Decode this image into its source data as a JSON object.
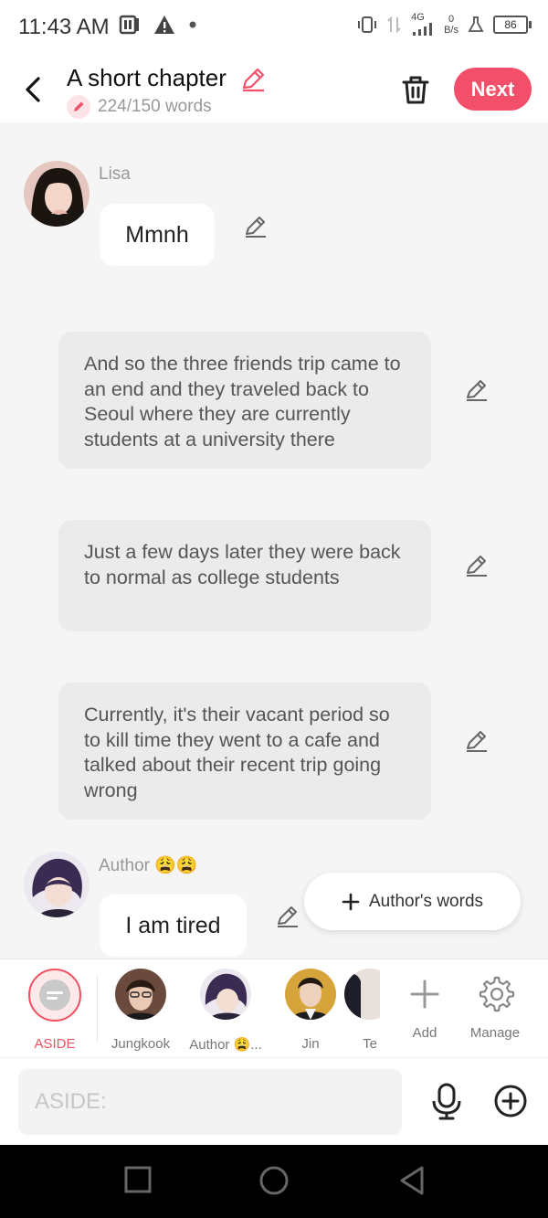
{
  "status": {
    "time": "11:43 AM",
    "network": "4G",
    "speed_value": "0",
    "speed_unit": "B/s",
    "battery": "86"
  },
  "header": {
    "title": "A short chapter",
    "word_count": "224/150 words",
    "next_label": "Next"
  },
  "messages": {
    "lisa": {
      "sender": "Lisa",
      "text": "Mmnh"
    },
    "narration1": "And so the three friends trip came to an end and they traveled back to Seoul where they are currently students at a university there",
    "narration2": "Just a few days later they were back to normal as college students",
    "narration3": "Currently, it's their vacant period so to kill time they went to a cafe and talked about their recent trip going wrong",
    "author": {
      "sender": "Author 😩😩",
      "text": "I am tired"
    }
  },
  "authors_words_label": "Author's words",
  "characters": [
    {
      "name": "ASIDE"
    },
    {
      "name": "Jungkook"
    },
    {
      "name": "Author 😩..."
    },
    {
      "name": "Jin"
    },
    {
      "name": "Te"
    },
    {
      "name": "Add"
    },
    {
      "name": "Manage"
    }
  ],
  "input": {
    "placeholder": "ASIDE:"
  },
  "colors": {
    "accent": "#f44f6a",
    "aside_ring": "#f0505f"
  }
}
